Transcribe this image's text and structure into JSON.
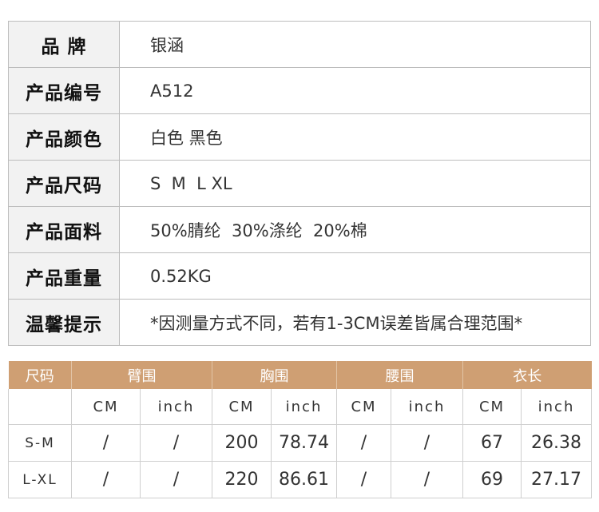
{
  "info": [
    {
      "key": "品 牌",
      "value": "银涵"
    },
    {
      "key": "产品编号",
      "value": "A512"
    },
    {
      "key": "产品颜色",
      "value": "白色 黑色"
    },
    {
      "key": "产品尺码",
      "value": "S  M  L XL"
    },
    {
      "key": "产品面料",
      "value": "50%腈纶  30%涤纶  20%棉"
    },
    {
      "key": "产品重量",
      "value": "0.52KG"
    },
    {
      "key": "温馨提示",
      "value": "*因测量方式不同，若有1-3CM误差皆属合理范围*"
    }
  ],
  "size_table": {
    "headers": [
      "尺码",
      "臂围",
      "胸围",
      "腰围",
      "衣长"
    ],
    "units": [
      "CM",
      "inch",
      "CM",
      "inch",
      "CM",
      "inch",
      "CM",
      "inch"
    ],
    "rows": [
      {
        "size": "S-M",
        "cells": [
          "/",
          "/",
          "200",
          "78.74",
          "/",
          "/",
          "67",
          "26.38"
        ]
      },
      {
        "size": "L-XL",
        "cells": [
          "/",
          "/",
          "220",
          "86.61",
          "/",
          "/",
          "69",
          "27.17"
        ]
      }
    ]
  },
  "colors": {
    "header_bg": "#cf9f73",
    "label_bg": "#f2f2f2"
  }
}
